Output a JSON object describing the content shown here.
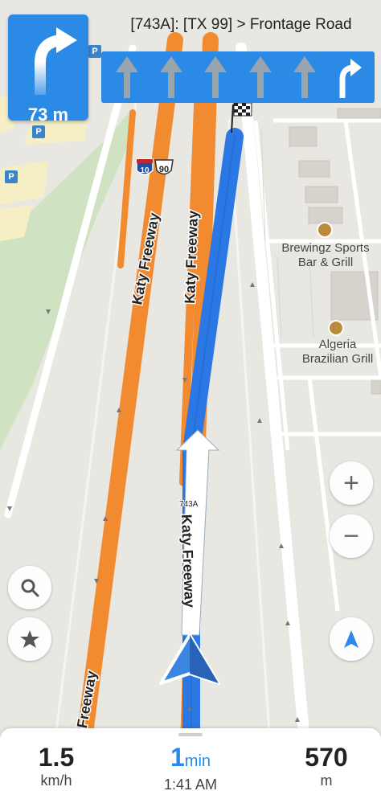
{
  "navigation": {
    "turn_distance": "73 m",
    "next_street": "[743A]: [TX 99] > Frontage Road",
    "lanes": [
      "straight-arrow-icon",
      "straight-arrow-icon",
      "straight-arrow-icon",
      "straight-arrow-icon",
      "straight-arrow-icon",
      "right-turn-arrow-icon"
    ]
  },
  "map": {
    "road_labels": {
      "katy_freeway_1": "Katy Freeway",
      "katy_freeway_2": "Katy Freeway",
      "katy_freeway_3": "Katy Freeway",
      "katy_freeway_route": "Katy Freeway",
      "exit_label": "743A"
    },
    "shields": {
      "interstate": "10",
      "us_route": "90"
    },
    "pois": [
      {
        "name_line1": "Brewingz Sports",
        "name_line2": "Bar & Grill",
        "icon": "restaurant-icon"
      },
      {
        "name_line1": "Algeria",
        "name_line2": "Brazilian Grill",
        "icon": "restaurant-icon"
      }
    ],
    "parking_label": "P"
  },
  "controls": {
    "zoom_in": "+",
    "zoom_out": "−"
  },
  "trip": {
    "speed_value": "1.5",
    "speed_unit": "km/h",
    "time_value": "1",
    "time_unit": "min",
    "arrival_time": "1:41 AM",
    "distance_value": "570",
    "distance_unit": "m"
  },
  "colors": {
    "accent": "#2b8ae6",
    "freeway": "#f28a30",
    "route": "#2b78e4"
  }
}
